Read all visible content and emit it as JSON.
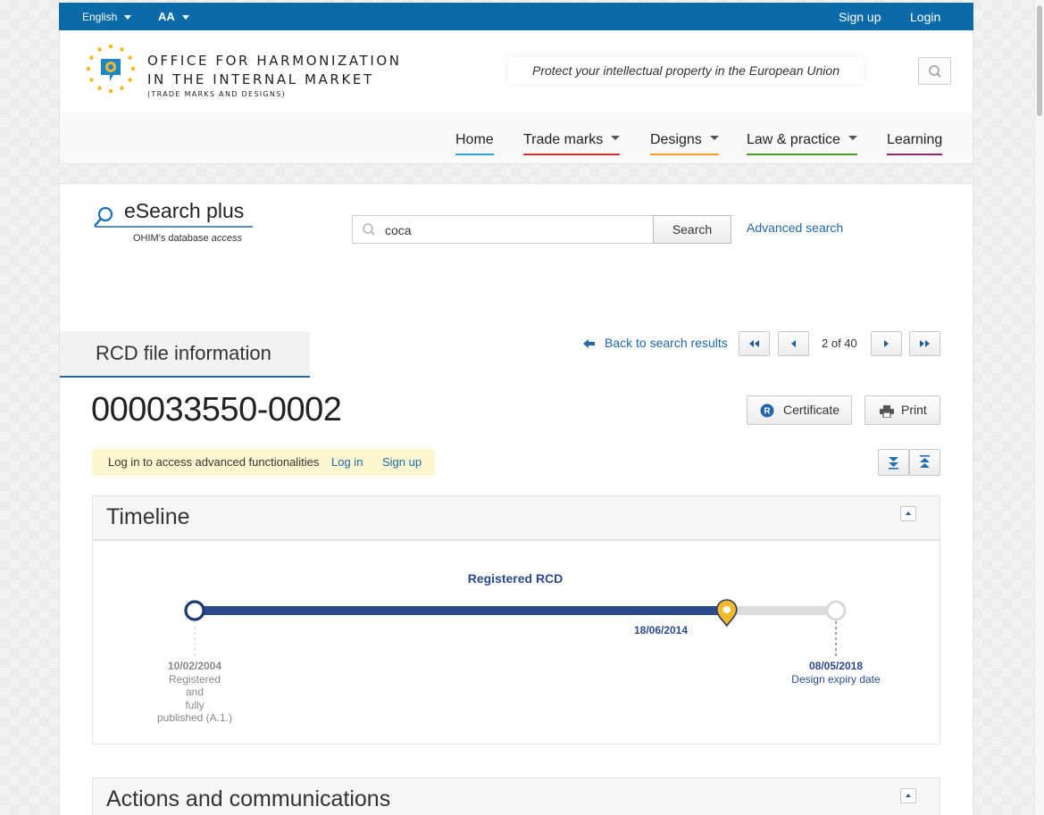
{
  "topbar": {
    "language": "English",
    "text_size": "AA",
    "signup": "Sign up",
    "login": "Login"
  },
  "header": {
    "org_line1": "OFFICE FOR HARMONIZATION",
    "org_line2": "IN THE INTERNAL MARKET",
    "org_line3": "(TRADE MARKS AND DESIGNS)",
    "tagline": "Protect your intellectual property in the European Union",
    "search_icon": "search-icon"
  },
  "nav": {
    "items": [
      {
        "label": "Home",
        "color": "#2a9fd6",
        "has_dropdown": false
      },
      {
        "label": "Trade marks",
        "color": "#d0342c",
        "has_dropdown": true
      },
      {
        "label": "Designs",
        "color": "#f0a229",
        "has_dropdown": true
      },
      {
        "label": "Law & practice",
        "color": "#4a9a2b",
        "has_dropdown": true
      },
      {
        "label": "Learning",
        "color": "#8b2a6e",
        "has_dropdown": false
      }
    ]
  },
  "esearch": {
    "title": "eSearch plus",
    "subtitle_main": "OHIM's database",
    "subtitle_italic": "access",
    "query": "coca",
    "search_button": "Search",
    "advanced_link": "Advanced search"
  },
  "record": {
    "tab_label": "RCD file information",
    "back_link": "Back to search results",
    "pager": "2 of 40",
    "number": "000033550-0002",
    "certificate_button": "Certificate",
    "print_button": "Print",
    "login_notice": "Log in to access advanced functionalities",
    "login_link": "Log in",
    "signup_link": "Sign up"
  },
  "timeline": {
    "title": "Timeline",
    "status_label": "Registered RCD",
    "progress": 0.83,
    "current_date": "18/06/2014",
    "start_date": "10/02/2004",
    "start_desc_1": "Registered",
    "start_desc_2": "and",
    "start_desc_3": "fully",
    "start_desc_4": "published (A.1.)",
    "end_date": "08/05/2018",
    "end_desc": "Design expiry date"
  },
  "actions_section": {
    "title": "Actions and communications"
  },
  "colors": {
    "topbar": "#0b6aa8",
    "link": "#1f67a8",
    "timeline_fill": "#2b4a8c",
    "marker": "#f2b92c"
  }
}
